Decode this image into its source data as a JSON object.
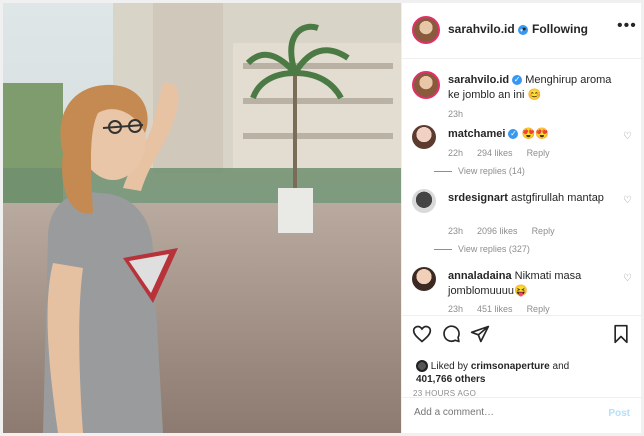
{
  "post": {
    "username": "sarahvilo.id",
    "dot": "•",
    "following": "Following",
    "more": "•••",
    "caption": "Menghirup aroma ke jomblo an ini 😊",
    "caption_time": "23h"
  },
  "comments": [
    {
      "user": "matchamei",
      "text": "😍😍",
      "time": "22h",
      "likes": "294 likes",
      "reply": "Reply",
      "view_replies": "View replies (14)"
    },
    {
      "user": "srdesignart",
      "text": "astgfirullah mantap",
      "time": "23h",
      "likes": "2096 likes",
      "reply": "Reply",
      "view_replies": "View replies (327)"
    },
    {
      "user": "annaladaina",
      "text": "Nikmati masa jomblomuuuu😝",
      "time": "23h",
      "likes": "451 likes",
      "reply": "Reply"
    }
  ],
  "actions": {
    "liked_by_prefix": "Liked by",
    "liked_by_user": "crimsonaperture",
    "liked_by_and": "and",
    "liked_by_count": "401,766 others",
    "timestamp": "23 HOURS AGO"
  },
  "composer": {
    "placeholder": "Add a comment…",
    "post_label": "Post"
  },
  "icons": [
    "heart-icon",
    "comment-icon",
    "share-icon",
    "bookmark-icon",
    "verified-icon",
    "more-icon"
  ],
  "colors": {
    "verified": "#3897f0",
    "post_disabled": "#b2dffc",
    "muted": "#8e8e8e"
  }
}
